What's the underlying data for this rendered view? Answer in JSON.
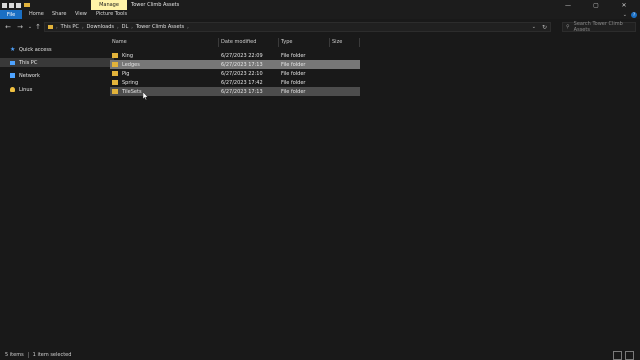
{
  "window": {
    "title": "Tower Climb Assets",
    "manage_tab": "Manage",
    "minimize": "—",
    "maximize": "▢",
    "close": "✕"
  },
  "ribbon": {
    "tabs": [
      "File",
      "Home",
      "Share",
      "View",
      "Picture Tools"
    ],
    "help": "?"
  },
  "nav": {
    "back": "←",
    "forward": "→",
    "recent": "⌄",
    "up": "↑",
    "refresh": "↻",
    "breadcrumbs": [
      "This PC",
      "Downloads",
      "DL",
      "Tower Climb Assets"
    ],
    "search_placeholder": "Search Tower Climb Assets"
  },
  "sidebar": {
    "items": [
      {
        "label": "Quick access",
        "icon": "star-icon"
      },
      {
        "label": "This PC",
        "icon": "computer-icon"
      },
      {
        "label": "Network",
        "icon": "network-icon"
      },
      {
        "label": "Linux",
        "icon": "linux-icon"
      }
    ]
  },
  "columns": [
    "Name",
    "Date modified",
    "Type",
    "Size"
  ],
  "files": [
    {
      "name": "King",
      "date": "6/27/2023 22:09",
      "type": "File folder",
      "state": "normal"
    },
    {
      "name": "Ledges",
      "date": "6/27/2023 17:13",
      "type": "File folder",
      "state": "selected"
    },
    {
      "name": "Pig",
      "date": "6/27/2023 22:10",
      "type": "File folder",
      "state": "normal"
    },
    {
      "name": "Spring",
      "date": "6/27/2023 17:42",
      "type": "File folder",
      "state": "normal"
    },
    {
      "name": "TileSets",
      "date": "6/27/2023 17:13",
      "type": "File folder",
      "state": "hover"
    }
  ],
  "status": {
    "items": "5 items",
    "selected": "1 item selected"
  },
  "colors": {
    "accent": "#1a6fc4",
    "manage": "#fff3a8",
    "folder": "#e2b33b",
    "selection": "#777777"
  }
}
